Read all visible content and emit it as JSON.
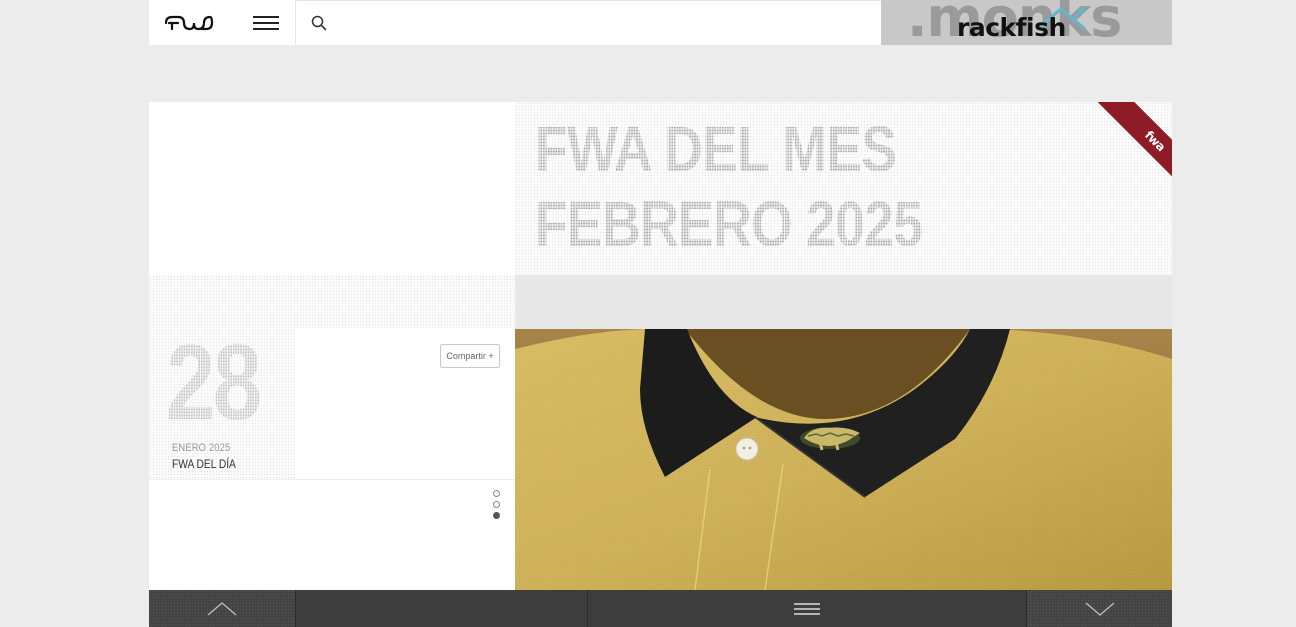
{
  "header": {
    "logo_text": "FWA",
    "search": {
      "placeholder": "",
      "value": ""
    },
    "banner": {
      "bg_text": ".monks",
      "fg_text": "rackfish"
    }
  },
  "feature": {
    "title_line1": "FWA DEL MES",
    "title_line2": "FEBRERO 2025",
    "ribbon_text": "fwa"
  },
  "day": {
    "number": "28",
    "month": "ENERO 2025",
    "label": "FWA DEL DÍA",
    "share_label": "Compartir +"
  },
  "pager": {
    "count": 3,
    "active_index": 2
  },
  "colors": {
    "accent_ribbon": "#8e1c27",
    "bottom_bar": "#3d3d3d",
    "page_bg": "#ececec",
    "shirt": "#d4b466",
    "collar": "#1e1e1e"
  },
  "icons": {
    "logo": "fwa-logo-icon",
    "menu": "hamburger-icon",
    "search": "search-icon",
    "up": "chevron-up-icon",
    "down": "chevron-down-icon"
  }
}
